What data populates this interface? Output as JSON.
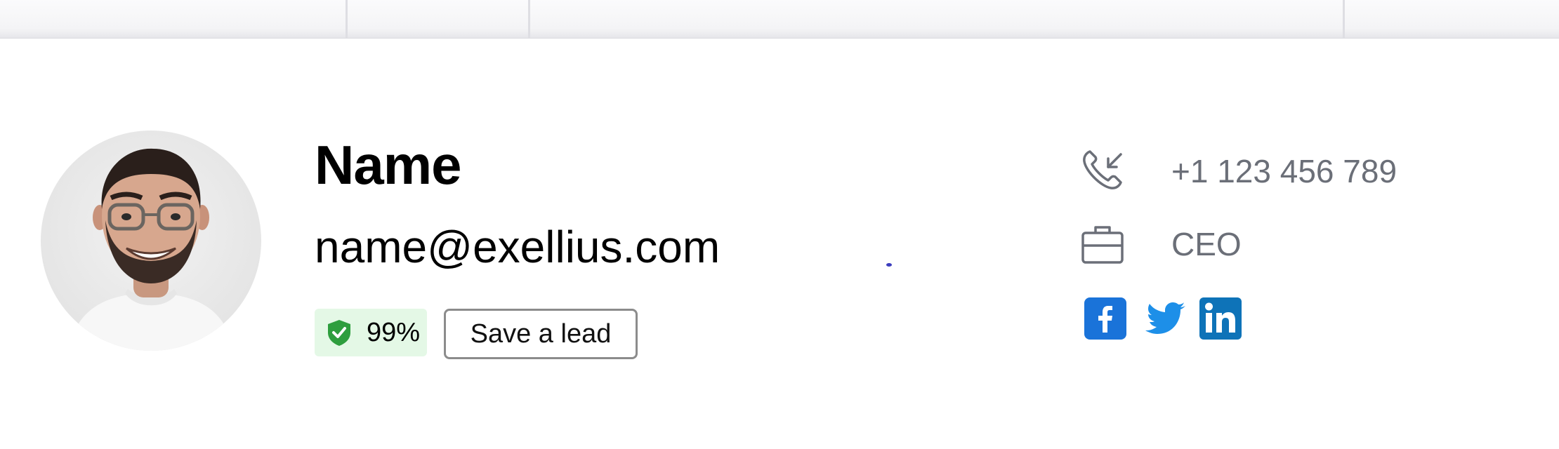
{
  "profile": {
    "name": "Name",
    "email": "name@exellius.com",
    "score": "99%",
    "save_lead_label": "Save a lead"
  },
  "contact": {
    "phone": "+1 123 456 789",
    "job_title": "CEO"
  },
  "social_links": [
    "facebook-icon",
    "twitter-icon",
    "linkedin-icon"
  ],
  "colors": {
    "badge_bg": "#e4f8e6",
    "shield_green": "#2e9e3e",
    "muted_text": "#6b6f78",
    "facebook_blue": "#1a73d9",
    "twitter_blue": "#1d8fe8",
    "linkedin_blue": "#0e73b8"
  }
}
